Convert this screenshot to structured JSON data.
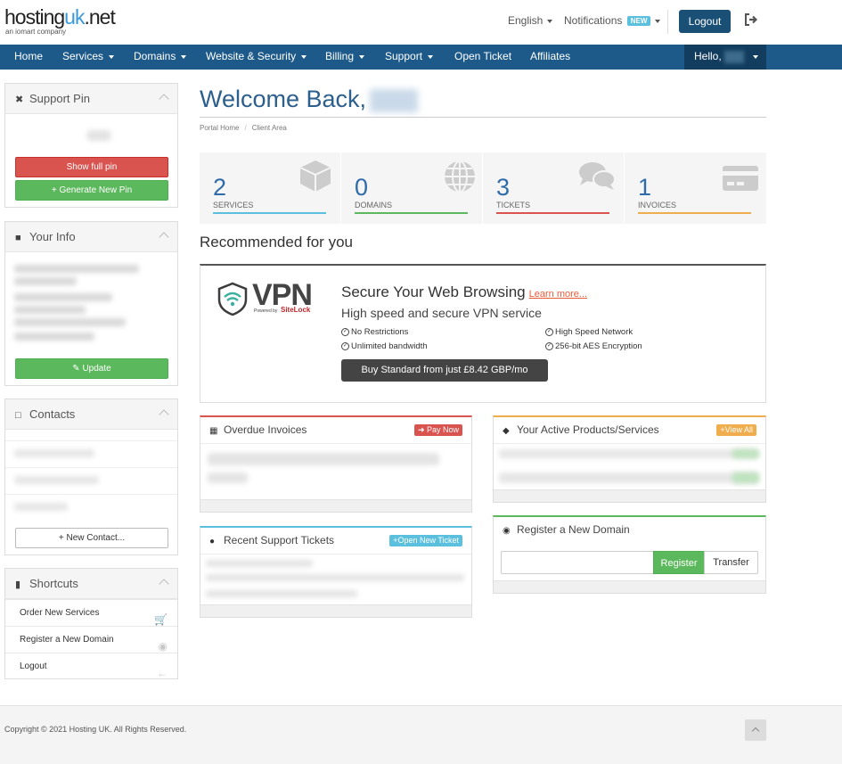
{
  "header": {
    "logo_text_main": "hosting",
    "logo_text_uk": "uk",
    "logo_text_tld": ".net",
    "logo_subtitle": "an iomart company",
    "language": "English",
    "notifications_label": "Notifications",
    "notifications_badge": "NEW",
    "logout_label": "Logout"
  },
  "nav": {
    "items": [
      {
        "label": "Home",
        "dropdown": false
      },
      {
        "label": "Services",
        "dropdown": true
      },
      {
        "label": "Domains",
        "dropdown": true
      },
      {
        "label": "Website & Security",
        "dropdown": true
      },
      {
        "label": "Billing",
        "dropdown": true
      },
      {
        "label": "Support",
        "dropdown": true
      },
      {
        "label": "Open Ticket",
        "dropdown": false
      },
      {
        "label": "Affiliates",
        "dropdown": false
      }
    ],
    "hello_label": "Hello,"
  },
  "sidebar": {
    "support_pin": {
      "title": "Support Pin",
      "show_full_pin_label": "Show full pin",
      "generate_pin_label": "Generate New Pin"
    },
    "your_info": {
      "title": "Your Info",
      "update_label": "Update"
    },
    "contacts": {
      "title": "Contacts",
      "new_contact_label": "New Contact..."
    },
    "shortcuts": {
      "title": "Shortcuts",
      "items": [
        {
          "label": "Order New Services",
          "icon": "cart-icon"
        },
        {
          "label": "Register a New Domain",
          "icon": "globe-icon"
        },
        {
          "label": "Logout",
          "icon": "arrow-left-icon"
        }
      ]
    }
  },
  "main": {
    "welcome": "Welcome Back,",
    "breadcrumb": [
      "Portal Home",
      "Client Area"
    ],
    "stats": [
      {
        "value": "2",
        "label": "SERVICES",
        "color": "#5bc0de",
        "icon": "cube-icon"
      },
      {
        "value": "0",
        "label": "DOMAINS",
        "color": "#5cb85c",
        "icon": "globe-icon"
      },
      {
        "value": "3",
        "label": "TICKETS",
        "color": "#d9534f",
        "icon": "comments-icon"
      },
      {
        "value": "1",
        "label": "INVOICES",
        "color": "#f0ad4e",
        "icon": "credit-card-icon"
      }
    ],
    "recommended_title": "Recommended for you",
    "vpn": {
      "logo_text": "VPN",
      "logo_powered": "Powered by",
      "logo_brand": "SiteLock",
      "heading": "Secure Your Web Browsing",
      "learn_more": "Learn more...",
      "subheading": "High speed and secure VPN service",
      "features": [
        "No Restrictions",
        "Unlimited bandwidth",
        "High Speed Network",
        "256-bit AES Encryption"
      ],
      "buy_label": "Buy Standard from just £8.42 GBP/mo"
    },
    "overdue": {
      "title": "Overdue Invoices",
      "action": "Pay Now"
    },
    "active_products": {
      "title": "Your Active Products/Services",
      "action": "View All"
    },
    "tickets": {
      "title": "Recent Support Tickets",
      "action": "Open New Ticket"
    },
    "register_domain": {
      "title": "Register a New Domain",
      "register_label": "Register",
      "transfer_label": "Transfer"
    }
  },
  "footer": {
    "copyright": "Copyright © 2021 Hosting UK. All Rights Reserved."
  },
  "colors": {
    "nav_bg": "#1d5a8a",
    "logout_btn": "#1a4f76",
    "red": "#d9534f",
    "green": "#5cb85c",
    "blue": "#5bc0de",
    "orange": "#f0ad4e"
  }
}
